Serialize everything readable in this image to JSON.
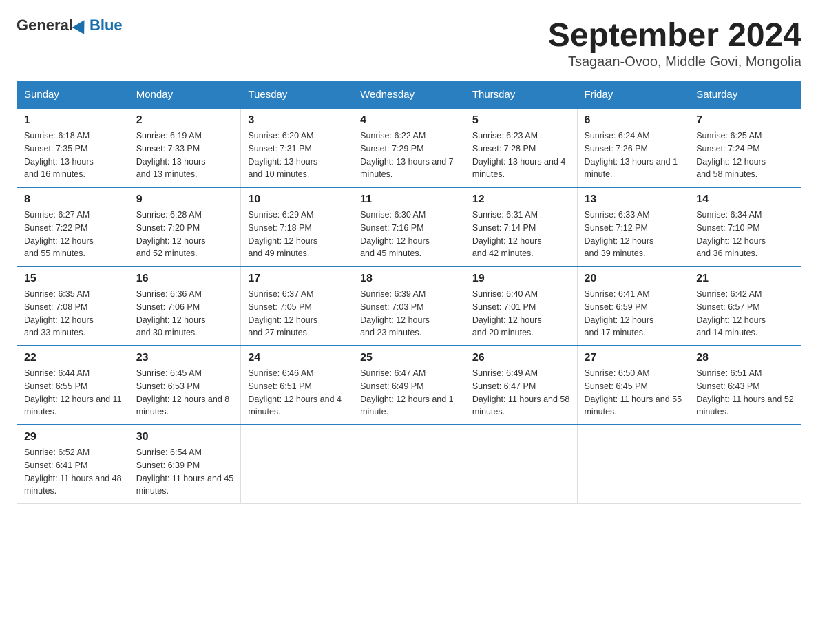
{
  "logo": {
    "general": "General",
    "blue": "Blue"
  },
  "title": "September 2024",
  "subtitle": "Tsagaan-Ovoo, Middle Govi, Mongolia",
  "headers": [
    "Sunday",
    "Monday",
    "Tuesday",
    "Wednesday",
    "Thursday",
    "Friday",
    "Saturday"
  ],
  "weeks": [
    [
      {
        "day": "1",
        "sunrise": "6:18 AM",
        "sunset": "7:35 PM",
        "daylight": "13 hours and 16 minutes."
      },
      {
        "day": "2",
        "sunrise": "6:19 AM",
        "sunset": "7:33 PM",
        "daylight": "13 hours and 13 minutes."
      },
      {
        "day": "3",
        "sunrise": "6:20 AM",
        "sunset": "7:31 PM",
        "daylight": "13 hours and 10 minutes."
      },
      {
        "day": "4",
        "sunrise": "6:22 AM",
        "sunset": "7:29 PM",
        "daylight": "13 hours and 7 minutes."
      },
      {
        "day": "5",
        "sunrise": "6:23 AM",
        "sunset": "7:28 PM",
        "daylight": "13 hours and 4 minutes."
      },
      {
        "day": "6",
        "sunrise": "6:24 AM",
        "sunset": "7:26 PM",
        "daylight": "13 hours and 1 minute."
      },
      {
        "day": "7",
        "sunrise": "6:25 AM",
        "sunset": "7:24 PM",
        "daylight": "12 hours and 58 minutes."
      }
    ],
    [
      {
        "day": "8",
        "sunrise": "6:27 AM",
        "sunset": "7:22 PM",
        "daylight": "12 hours and 55 minutes."
      },
      {
        "day": "9",
        "sunrise": "6:28 AM",
        "sunset": "7:20 PM",
        "daylight": "12 hours and 52 minutes."
      },
      {
        "day": "10",
        "sunrise": "6:29 AM",
        "sunset": "7:18 PM",
        "daylight": "12 hours and 49 minutes."
      },
      {
        "day": "11",
        "sunrise": "6:30 AM",
        "sunset": "7:16 PM",
        "daylight": "12 hours and 45 minutes."
      },
      {
        "day": "12",
        "sunrise": "6:31 AM",
        "sunset": "7:14 PM",
        "daylight": "12 hours and 42 minutes."
      },
      {
        "day": "13",
        "sunrise": "6:33 AM",
        "sunset": "7:12 PM",
        "daylight": "12 hours and 39 minutes."
      },
      {
        "day": "14",
        "sunrise": "6:34 AM",
        "sunset": "7:10 PM",
        "daylight": "12 hours and 36 minutes."
      }
    ],
    [
      {
        "day": "15",
        "sunrise": "6:35 AM",
        "sunset": "7:08 PM",
        "daylight": "12 hours and 33 minutes."
      },
      {
        "day": "16",
        "sunrise": "6:36 AM",
        "sunset": "7:06 PM",
        "daylight": "12 hours and 30 minutes."
      },
      {
        "day": "17",
        "sunrise": "6:37 AM",
        "sunset": "7:05 PM",
        "daylight": "12 hours and 27 minutes."
      },
      {
        "day": "18",
        "sunrise": "6:39 AM",
        "sunset": "7:03 PM",
        "daylight": "12 hours and 23 minutes."
      },
      {
        "day": "19",
        "sunrise": "6:40 AM",
        "sunset": "7:01 PM",
        "daylight": "12 hours and 20 minutes."
      },
      {
        "day": "20",
        "sunrise": "6:41 AM",
        "sunset": "6:59 PM",
        "daylight": "12 hours and 17 minutes."
      },
      {
        "day": "21",
        "sunrise": "6:42 AM",
        "sunset": "6:57 PM",
        "daylight": "12 hours and 14 minutes."
      }
    ],
    [
      {
        "day": "22",
        "sunrise": "6:44 AM",
        "sunset": "6:55 PM",
        "daylight": "12 hours and 11 minutes."
      },
      {
        "day": "23",
        "sunrise": "6:45 AM",
        "sunset": "6:53 PM",
        "daylight": "12 hours and 8 minutes."
      },
      {
        "day": "24",
        "sunrise": "6:46 AM",
        "sunset": "6:51 PM",
        "daylight": "12 hours and 4 minutes."
      },
      {
        "day": "25",
        "sunrise": "6:47 AM",
        "sunset": "6:49 PM",
        "daylight": "12 hours and 1 minute."
      },
      {
        "day": "26",
        "sunrise": "6:49 AM",
        "sunset": "6:47 PM",
        "daylight": "11 hours and 58 minutes."
      },
      {
        "day": "27",
        "sunrise": "6:50 AM",
        "sunset": "6:45 PM",
        "daylight": "11 hours and 55 minutes."
      },
      {
        "day": "28",
        "sunrise": "6:51 AM",
        "sunset": "6:43 PM",
        "daylight": "11 hours and 52 minutes."
      }
    ],
    [
      {
        "day": "29",
        "sunrise": "6:52 AM",
        "sunset": "6:41 PM",
        "daylight": "11 hours and 48 minutes."
      },
      {
        "day": "30",
        "sunrise": "6:54 AM",
        "sunset": "6:39 PM",
        "daylight": "11 hours and 45 minutes."
      },
      null,
      null,
      null,
      null,
      null
    ]
  ],
  "labels": {
    "sunrise": "Sunrise:",
    "sunset": "Sunset:",
    "daylight": "Daylight:"
  }
}
